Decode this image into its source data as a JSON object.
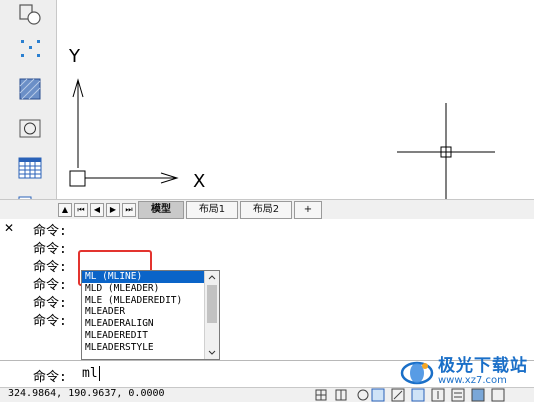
{
  "tabs": [
    "模型",
    "布局1",
    "布局2",
    "+"
  ],
  "axes": {
    "y_label": "Y",
    "x_label": "X"
  },
  "command_prompt": "命令:",
  "history_count": 6,
  "autocomplete": {
    "items": [
      "ML (MLINE)",
      "MLD (MLEADER)",
      "MLE (MLEADEREDIT)",
      "MLEADER",
      "MLEADERALIGN",
      "MLEADEREDIT",
      "MLEADERSTYLE"
    ],
    "selected_index": 0
  },
  "input_value": "ml",
  "status_coords": "324.9864, 190.9637, 0.0000",
  "watermark": {
    "title": "极光下载站",
    "url": "www.xz7.com"
  },
  "colors": {
    "selection": "#0a64c8",
    "highlight_box": "#e3342f",
    "watermark": "#1a6fc8"
  }
}
